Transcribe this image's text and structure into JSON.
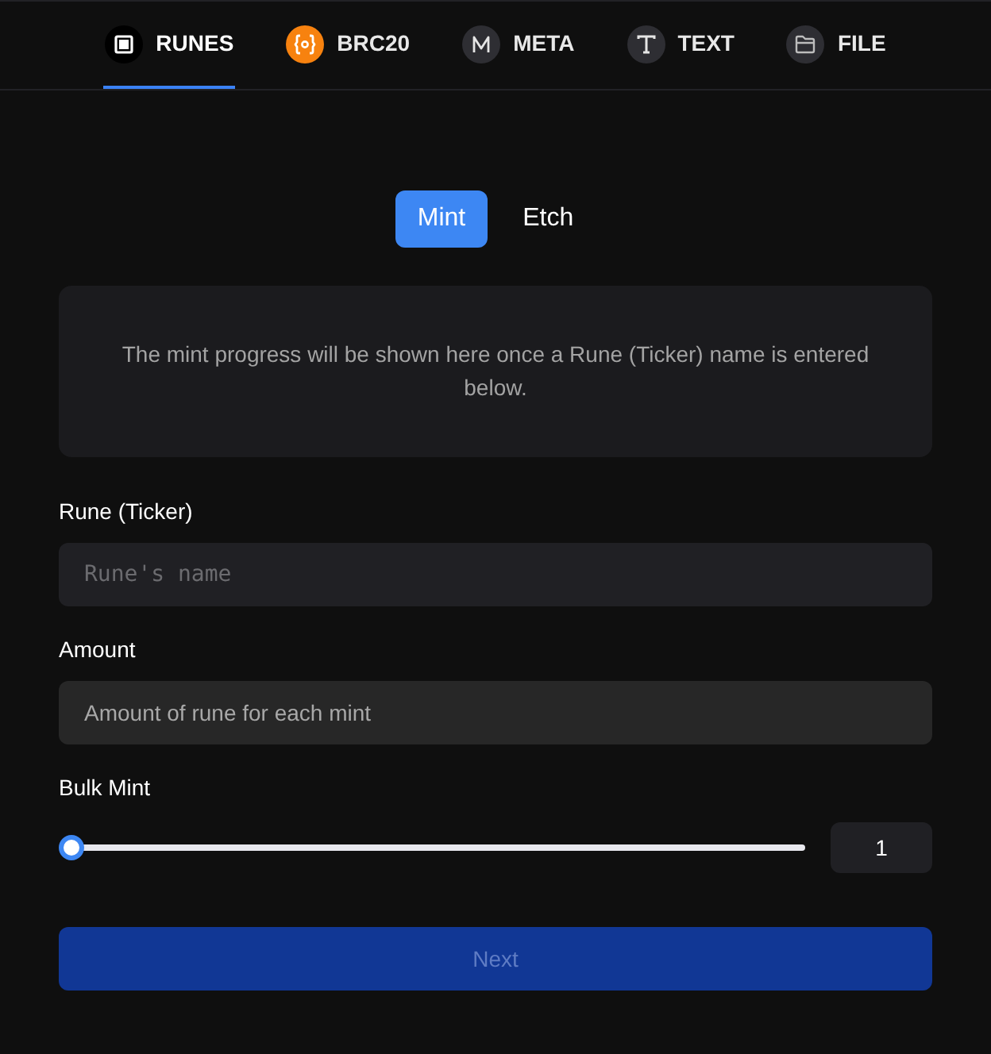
{
  "tabs": [
    {
      "label": "RUNES",
      "selected": true
    },
    {
      "label": "BRC20",
      "selected": false
    },
    {
      "label": "META",
      "selected": false
    },
    {
      "label": "TEXT",
      "selected": false
    },
    {
      "label": "FILE",
      "selected": false
    }
  ],
  "mode_toggle": [
    {
      "label": "Mint",
      "selected": true
    },
    {
      "label": "Etch",
      "selected": false
    }
  ],
  "info_panel": {
    "text": "The mint progress will be shown here once a Rune (Ticker) name is entered below."
  },
  "fields": [
    {
      "label": "Rune (Ticker)",
      "kind": "code",
      "placeholder": "Rune's name"
    },
    {
      "label": "Amount",
      "kind": "text",
      "placeholder": "Amount of rune for each mint"
    }
  ],
  "bulk_mint": {
    "label": "Bulk Mint",
    "level": 0,
    "reading": "1"
  },
  "next_button": {
    "label": "Next",
    "disabled": true
  }
}
